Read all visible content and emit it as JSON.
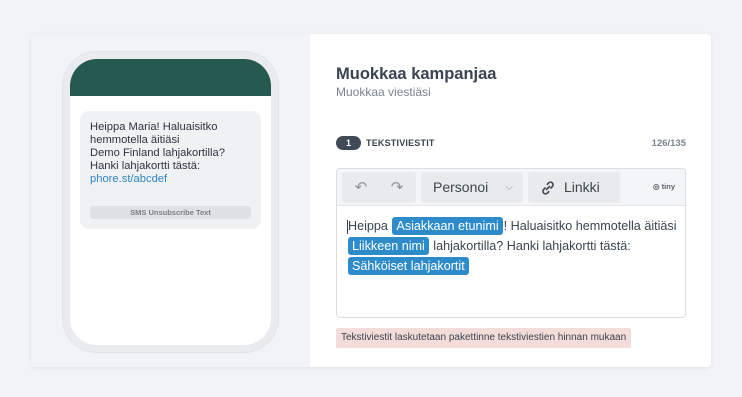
{
  "preview": {
    "message_lines": [
      "Heippa Maria!  Haluaisitko",
      "hemmotella äitiäsi",
      "Demo Finland lahjakortilla?",
      "Hanki lahjakortti tästä:"
    ],
    "link_text": "phore.st/abcdef",
    "unsubscribe_text": "SMS Unsubscribe Text",
    "header_color": "#265a50"
  },
  "header": {
    "title": "Muokkaa kampanjaa",
    "subtitle": "Muokkaa viestiäsi"
  },
  "step": {
    "number": "1",
    "label": "TEKSTIVIESTIT",
    "counter": "126/135"
  },
  "toolbar": {
    "undo_icon": "undo-icon",
    "redo_icon": "redo-icon",
    "personalize_label": "Personoi",
    "link_label": "Linkki",
    "brand": "tiny"
  },
  "editor": {
    "text_1": "Heippa",
    "chip_1": "Asiakkaan etunimi",
    "text_2": "!  Haluaisitko hemmotella äitiäsi",
    "chip_2": "Liikkeen nimi",
    "text_3": "lahjakortilla? Hanki lahjakortti tästä:",
    "chip_3": "Sähköiset lahjakortit",
    "chip_color": "#2d8bc9"
  },
  "notice": "Tekstiviestit laskutetaan pakettinne tekstiviestien hinnan mukaan"
}
